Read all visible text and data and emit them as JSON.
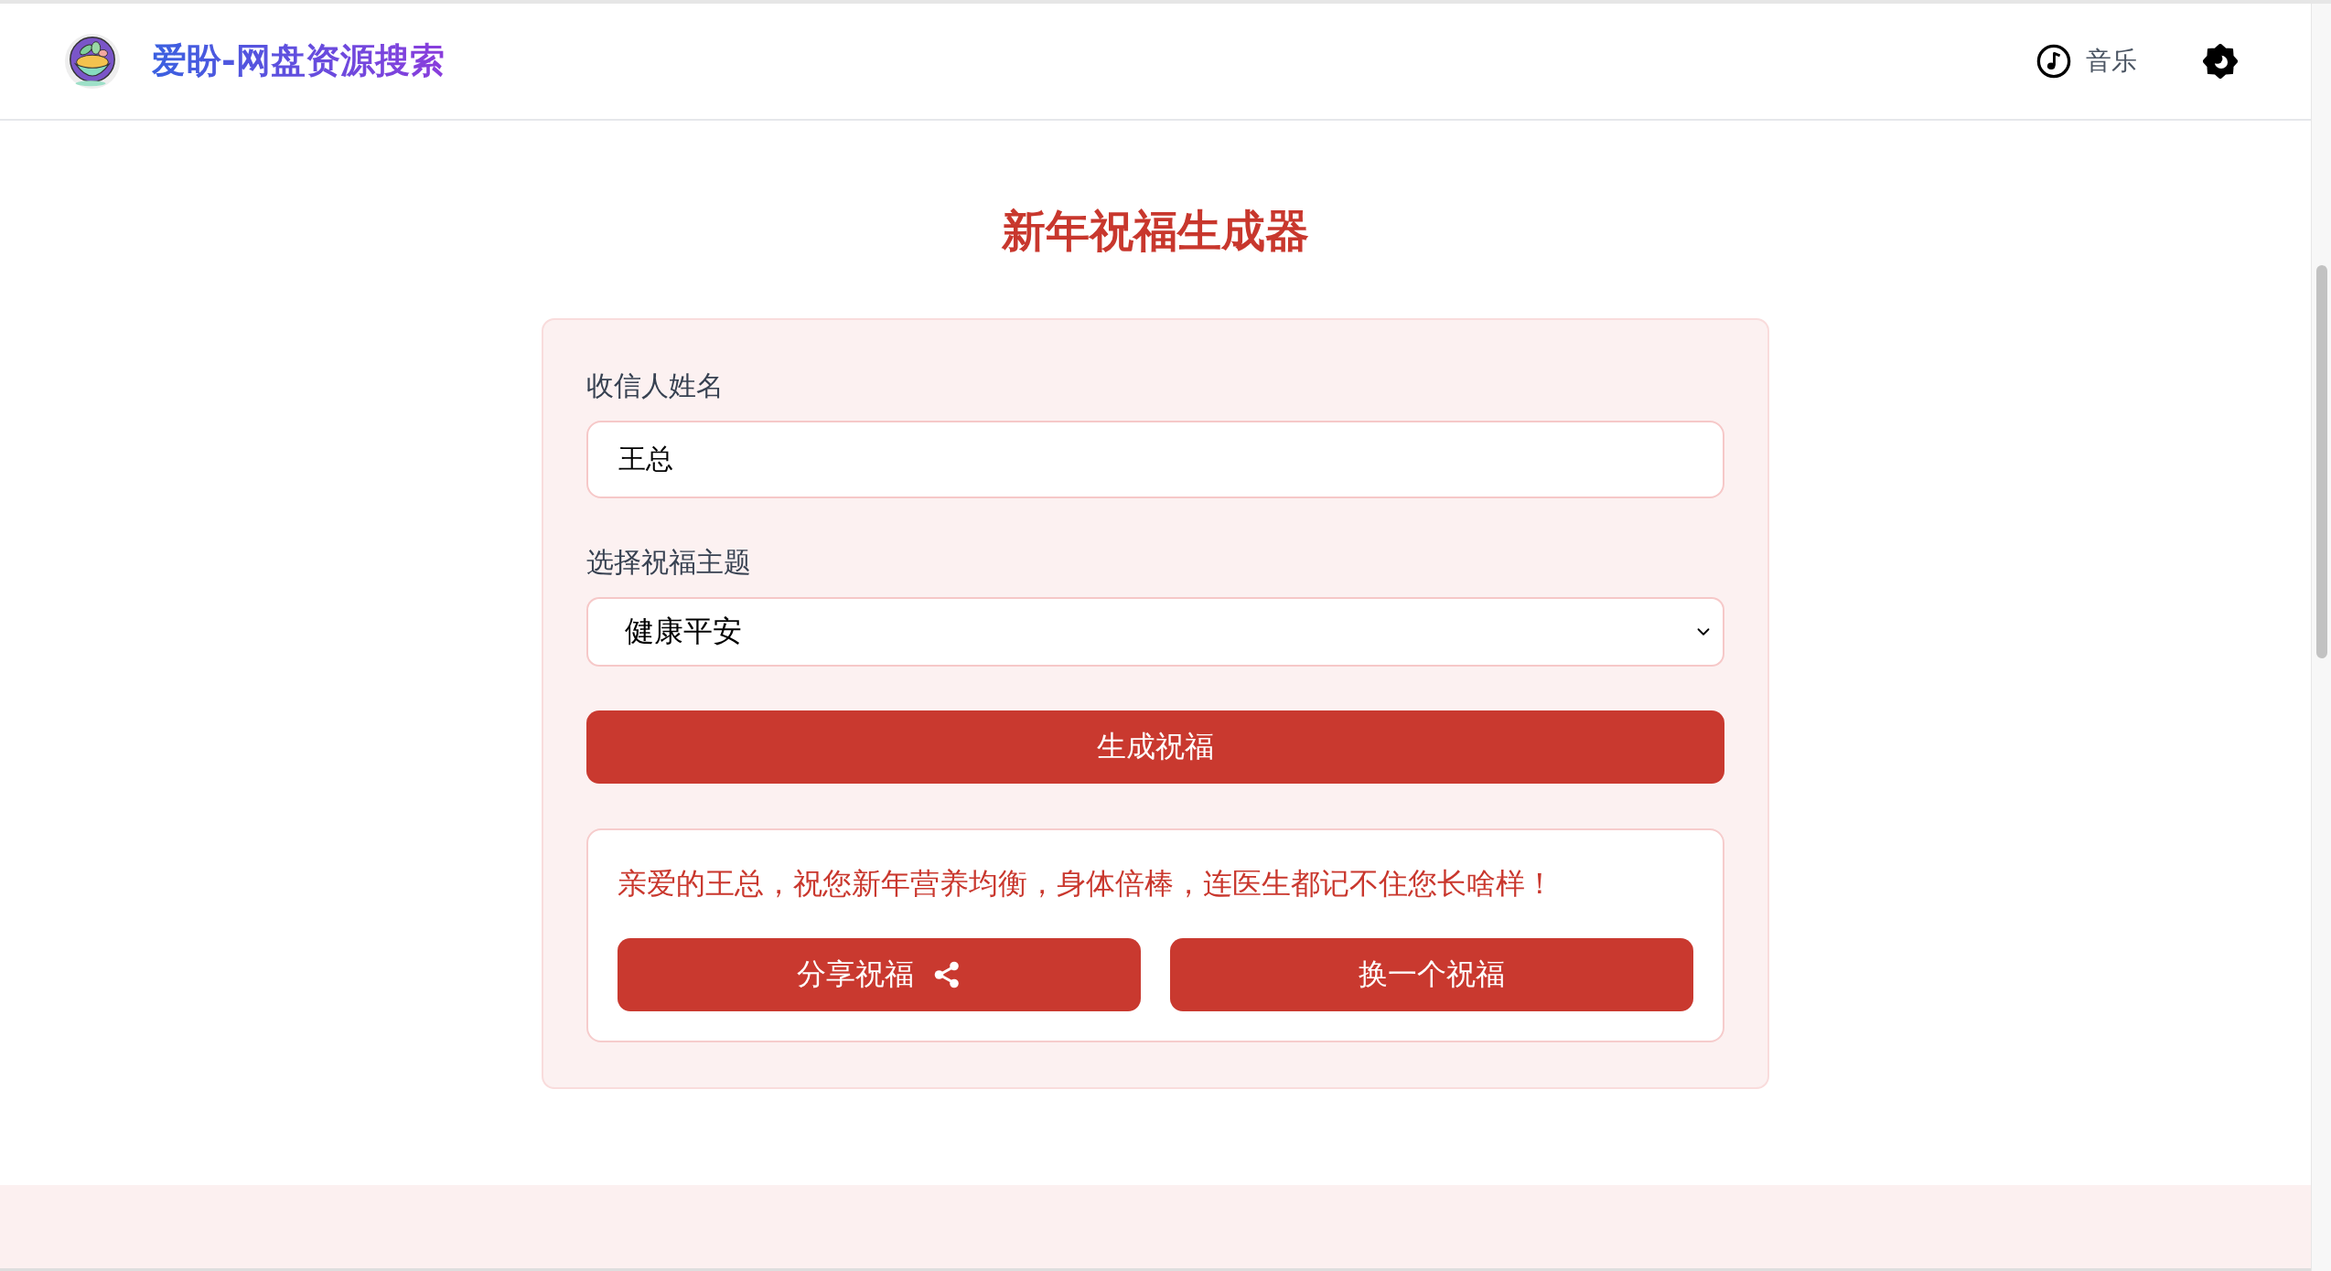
{
  "header": {
    "title": "爱盼-网盘资源搜索",
    "actions": [
      {
        "kind": "music",
        "label": "音乐"
      },
      {
        "kind": "settings"
      }
    ]
  },
  "page_title": "新年祝福生成器",
  "form": {
    "recipient": {
      "label": "收信人姓名",
      "value": "王总"
    },
    "theme": {
      "label": "选择祝福主题",
      "value": "健康平安"
    },
    "generate_button": "生成祝福"
  },
  "result": {
    "message": "亲爱的王总，祝您新年营养均衡，身体倍棒，连医生都记不住您长啥样！",
    "buttons": [
      {
        "kind": "share",
        "label": "分享祝福"
      },
      {
        "kind": "plain",
        "label": "换一个祝福"
      }
    ]
  }
}
